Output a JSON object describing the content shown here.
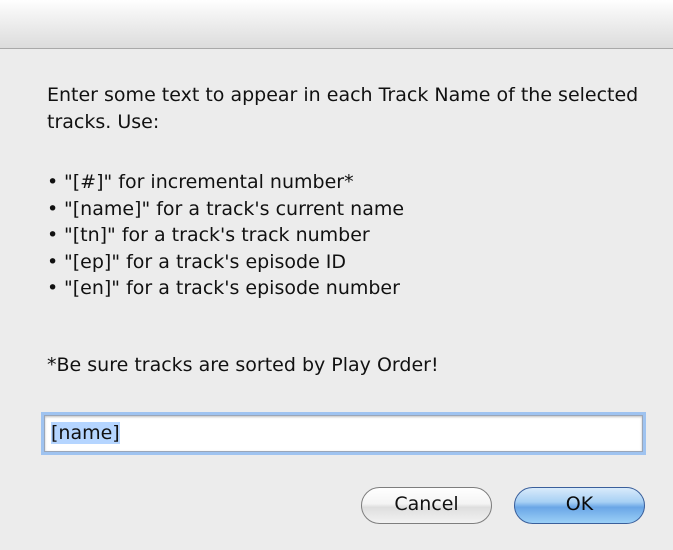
{
  "dialog": {
    "prompt": "Enter some text to appear in each Track Name of the selected tracks. Use:",
    "bullets": [
      "\"[#]\" for incremental number*",
      "\"[name]\" for a track's current name",
      "\"[tn]\" for a track's track number",
      "\"[ep]\" for a track's episode ID",
      "\"[en]\" for a track's episode number"
    ],
    "bullet_glyph": "•",
    "note": "*Be sure tracks are sorted by Play Order!",
    "input_value": "[name]",
    "cancel_label": "Cancel",
    "ok_label": "OK"
  },
  "colors": {
    "dialog_bg": "#ececec",
    "focus_ring": "#9fc3f0",
    "default_button": "#6aa6e6"
  }
}
